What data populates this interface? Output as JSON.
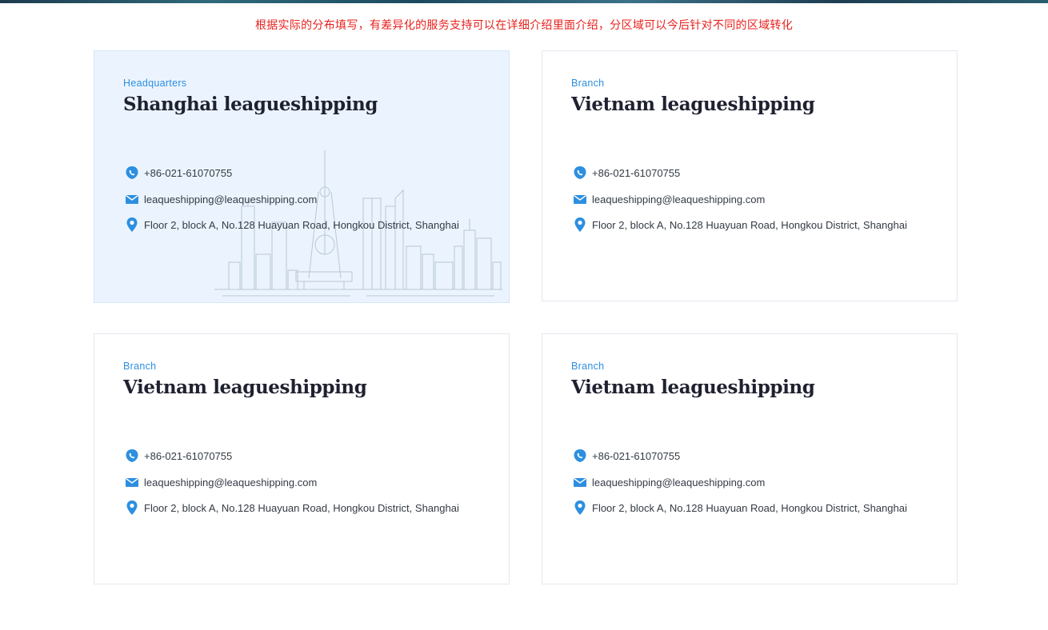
{
  "notice": "根据实际的分布填写，有差异化的服务支持可以在详细介绍里面介绍，分区域可以今后针对不同的区域转化",
  "colors": {
    "accent": "#2d8fe0",
    "notice": "#e8211d",
    "hq_background": "#ebf4fe"
  },
  "cards": [
    {
      "tag": "Headquarters",
      "name": "Shanghai leagueshipping",
      "phone": "+86-021-61070755",
      "email": "leaqueshipping@leaqueshipping.com",
      "address": "Floor 2, block A, No.128 Huayuan Road, Hongkou District, Shanghai",
      "illustration": "shanghai-skyline"
    },
    {
      "tag": "Branch",
      "name": "Vietnam leagueshipping",
      "phone": "+86-021-61070755",
      "email": "leaqueshipping@leaqueshipping.com",
      "address": "Floor 2, block A, No.128 Huayuan Road, Hongkou District, Shanghai"
    },
    {
      "tag": "Branch",
      "name": "Vietnam leagueshipping",
      "phone": "+86-021-61070755",
      "email": "leaqueshipping@leaqueshipping.com",
      "address": "Floor 2, block A, No.128 Huayuan Road, Hongkou District, Shanghai"
    },
    {
      "tag": "Branch",
      "name": "Vietnam leagueshipping",
      "phone": "+86-021-61070755",
      "email": "leaqueshipping@leaqueshipping.com",
      "address": "Floor 2, block A, No.128 Huayuan Road, Hongkou District, Shanghai"
    }
  ],
  "icons": {
    "phone": "phone-icon",
    "email": "email-icon",
    "location": "location-pin-icon"
  }
}
